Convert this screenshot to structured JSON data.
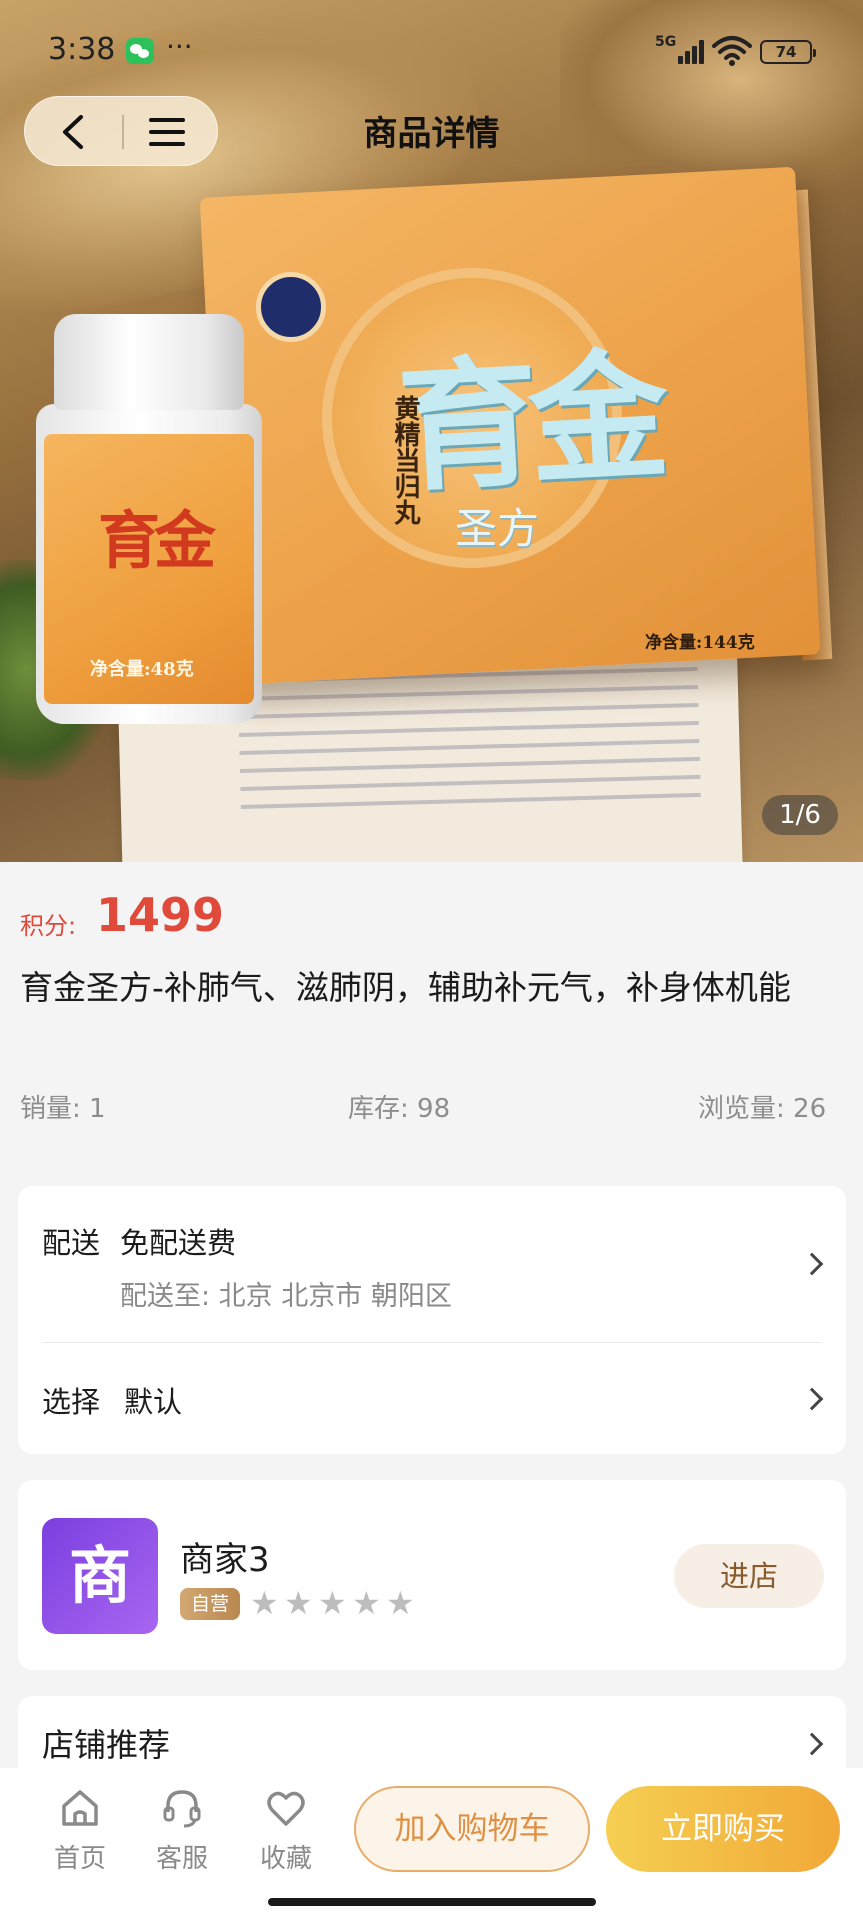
{
  "status_bar": {
    "time": "3:38",
    "more": "···",
    "network": "5G",
    "battery": "74"
  },
  "nav": {
    "title": "商品详情"
  },
  "gallery": {
    "counter": "1/6",
    "box_title": "育金",
    "box_subtitle": "圣方",
    "box_vertical_text": "黄精当归丸",
    "box_net_content": "净含量:144克",
    "bottle_title": "育金",
    "bottle_net_content": "净含量:48克"
  },
  "product": {
    "price_label": "积分:",
    "price": "1499",
    "title": "育金圣方-补肺气、滋肺阴，辅助补元气，补身体机能",
    "sales_label": "销量: 1",
    "stock_label": "库存: 98",
    "views_label": "浏览量: 26"
  },
  "delivery_card": {
    "delivery_label": "配送",
    "delivery_value": "免配送费",
    "delivery_to": "配送至: 北京 北京市 朝阳区",
    "select_label": "选择",
    "select_value": "默认"
  },
  "merchant": {
    "avatar_char": "商",
    "name": "商家3",
    "badge": "自营",
    "rating": 0,
    "rating_max": 5,
    "shop_button": "进店"
  },
  "recommend": {
    "title": "店铺推荐"
  },
  "bottom_bar": {
    "tabs": [
      {
        "label": "首页",
        "icon": "home-icon"
      },
      {
        "label": "客服",
        "icon": "headset-icon"
      },
      {
        "label": "收藏",
        "icon": "heart-icon"
      }
    ],
    "add_to_cart": "加入购物车",
    "buy_now": "立即购买"
  },
  "colors": {
    "price": "#e04a3a",
    "buy_gradient_start": "#f5cf52",
    "buy_gradient_end": "#f1a837",
    "cart_border": "#e9ad6a",
    "avatar": "#8b4be6"
  }
}
